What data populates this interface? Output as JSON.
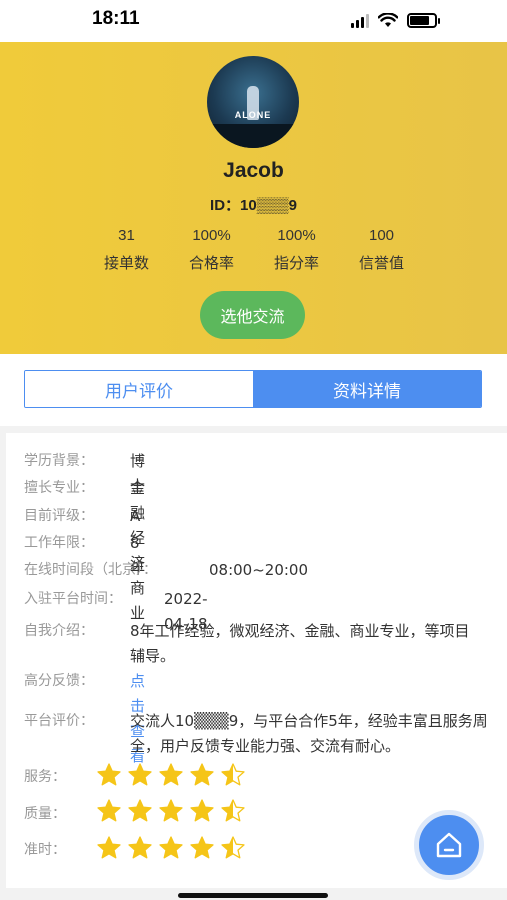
{
  "status_bar": {
    "time": "18:11"
  },
  "profile": {
    "avatar_text": "ALONE",
    "name": "Jacob",
    "id_label": "ID：10▒▒▒9"
  },
  "stats": [
    {
      "value": "31",
      "label": "接单数"
    },
    {
      "value": "100%",
      "label": "合格率"
    },
    {
      "value": "100%",
      "label": "指分率"
    },
    {
      "value": "100",
      "label": "信誉值"
    }
  ],
  "contact_button": "选他交流",
  "tabs": [
    {
      "label": "用户评价",
      "active": false
    },
    {
      "label": "资料详情",
      "active": true
    }
  ],
  "details": {
    "education": {
      "label": "学历背景：",
      "value": "博士"
    },
    "majors": {
      "label": "擅长专业：",
      "value": "金融 经济 商业"
    },
    "level": {
      "label": "目前评级：",
      "value": "A"
    },
    "years": {
      "label": "工作年限：",
      "value": "8年"
    },
    "online": {
      "label": "在线时间段（北京）：",
      "value": "08:00~20:00"
    },
    "joined": {
      "label": "入驻平台时间：",
      "value": "2022-04-18"
    },
    "intro": {
      "label": "自我介绍：",
      "value": "8年工作经验，微观经济、金融、商业专业，等项目辅导。"
    },
    "feedback": {
      "label": "高分反馈：",
      "value": "点击查看"
    },
    "platform": {
      "label": "平台评价：",
      "value": "交流人10▒▒▒9，与平台合作5年，经验丰富且服务周全，用户反馈专业能力强、交流有耐心。"
    }
  },
  "ratings": [
    {
      "label": "服务：",
      "stars": 4.5
    },
    {
      "label": "质量：",
      "stars": 4.5
    },
    {
      "label": "准时：",
      "stars": 4.5
    }
  ],
  "colors": {
    "accent": "#4d8ef0",
    "header": "#f0cb3a",
    "button": "#5cb85c",
    "star": "#f5c518"
  },
  "icons": {
    "fab": "home-icon"
  }
}
